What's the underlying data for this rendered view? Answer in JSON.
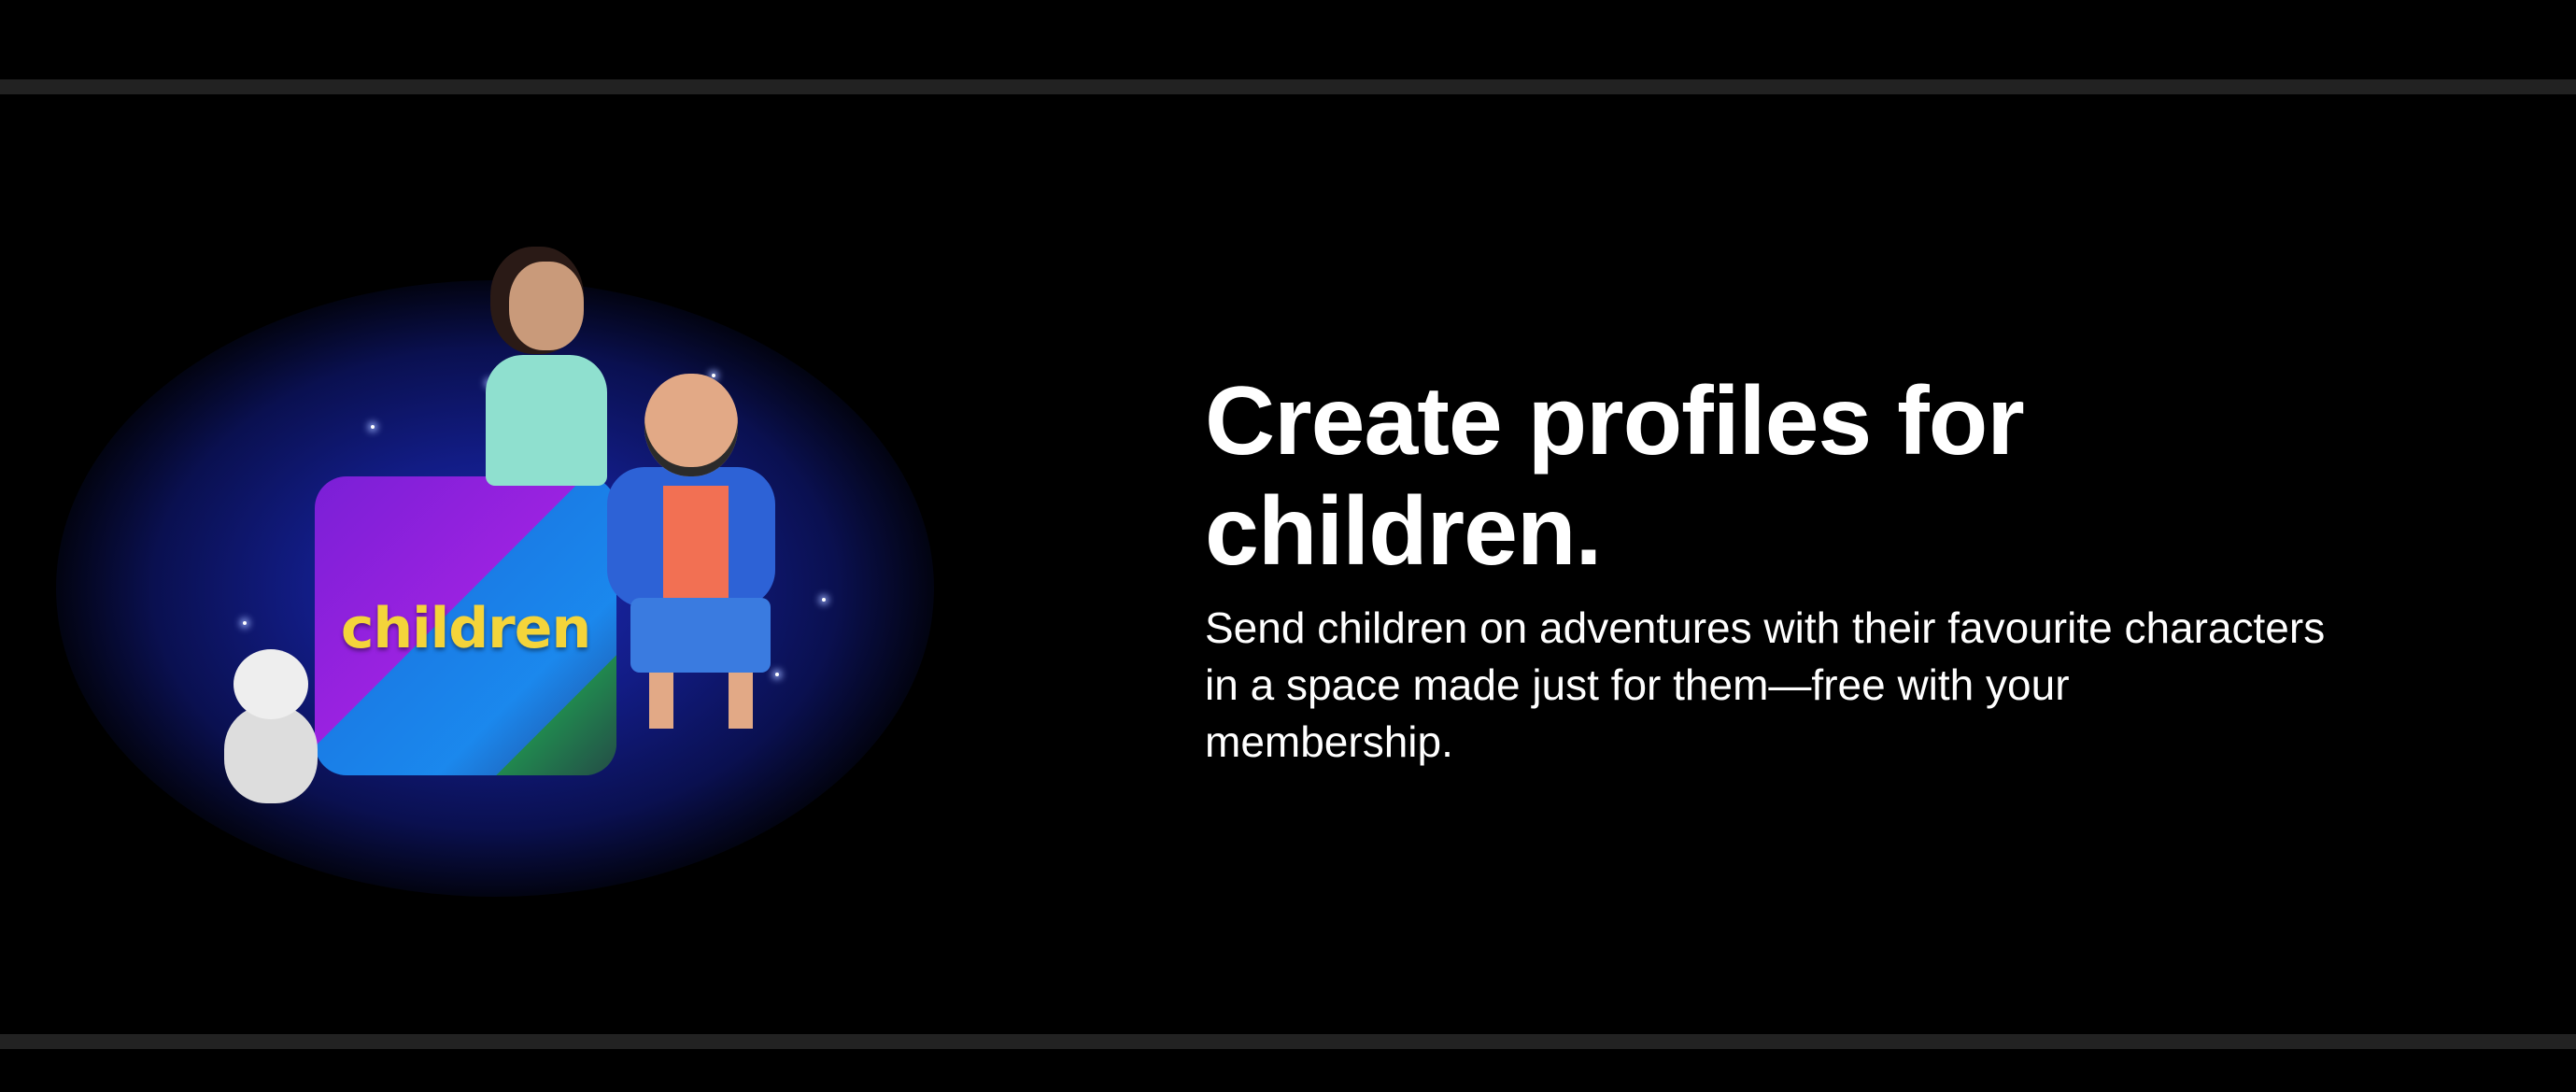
{
  "promo": {
    "tile_label": "children",
    "heading": "Create profiles for children.",
    "description": "Send children on adventures with their favourite characters in a space made just for them—free with your membership."
  },
  "colors": {
    "background": "#000000",
    "divider": "#222222",
    "tile_label": "#f4d43a",
    "text": "#ffffff"
  }
}
